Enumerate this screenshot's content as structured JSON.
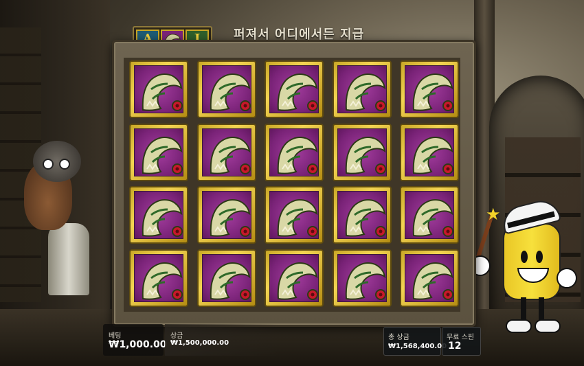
{
  "banner": {
    "title": "퍼져서 어디에서든 지급",
    "mini_symbols": [
      "A",
      "",
      "J"
    ]
  },
  "grid": {
    "columns": 5,
    "rows": 4,
    "symbol": "crocodile-head"
  },
  "bottom_bar": {
    "bet_label": "베팅",
    "bet_value": "₩1,000.00",
    "win_label": "상금",
    "win_value": "₩1,500,000.00",
    "total_win_label": "총 상금",
    "total_win_value": "₩1,568,400.00",
    "free_spins_label": "무료 스핀",
    "free_spins_value": "12"
  },
  "colors": {
    "symbol_gold": "#f3d452",
    "symbol_purple": "#7a2378",
    "frame": "#6e6451"
  }
}
